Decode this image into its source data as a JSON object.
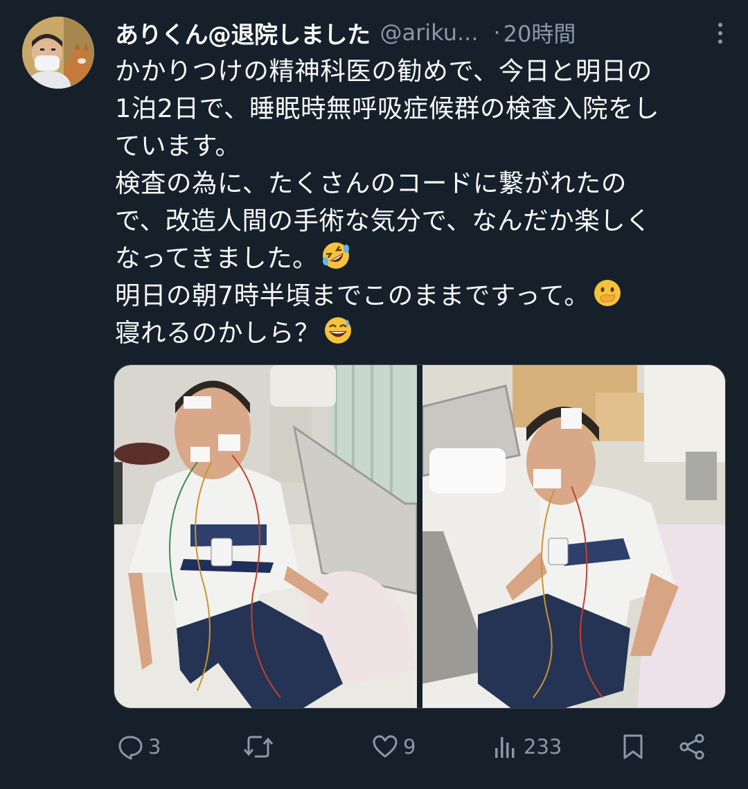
{
  "tweet": {
    "display_name": "ありくん@退院しました",
    "handle": "@ariku...",
    "separator": "·",
    "time": "20時間",
    "body_lines": [
      "かかりつけの精神科医の勧めで、今日と明日の",
      "1泊2日で、睡眠時無呼吸症候群の検査入院をし",
      "ています。",
      "検査の為に、たくさんのコードに繋がれたの",
      "で、改造人間の手術な気分で、なんだか楽しく",
      "なってきました。",
      "明日の朝7時半頃までこのままですって。",
      "寝れるのかしら？"
    ],
    "emojis": [
      "rolling-on-floor-laughing",
      "face-with-hand-over-mouth",
      "grinning-sweat"
    ]
  },
  "actions": {
    "reply_count": "3",
    "retweet_count": "",
    "like_count": "9",
    "views_count": "233"
  },
  "colors": {
    "background": "#15202b",
    "text": "#f7f9f9",
    "muted": "#8b98a5"
  }
}
